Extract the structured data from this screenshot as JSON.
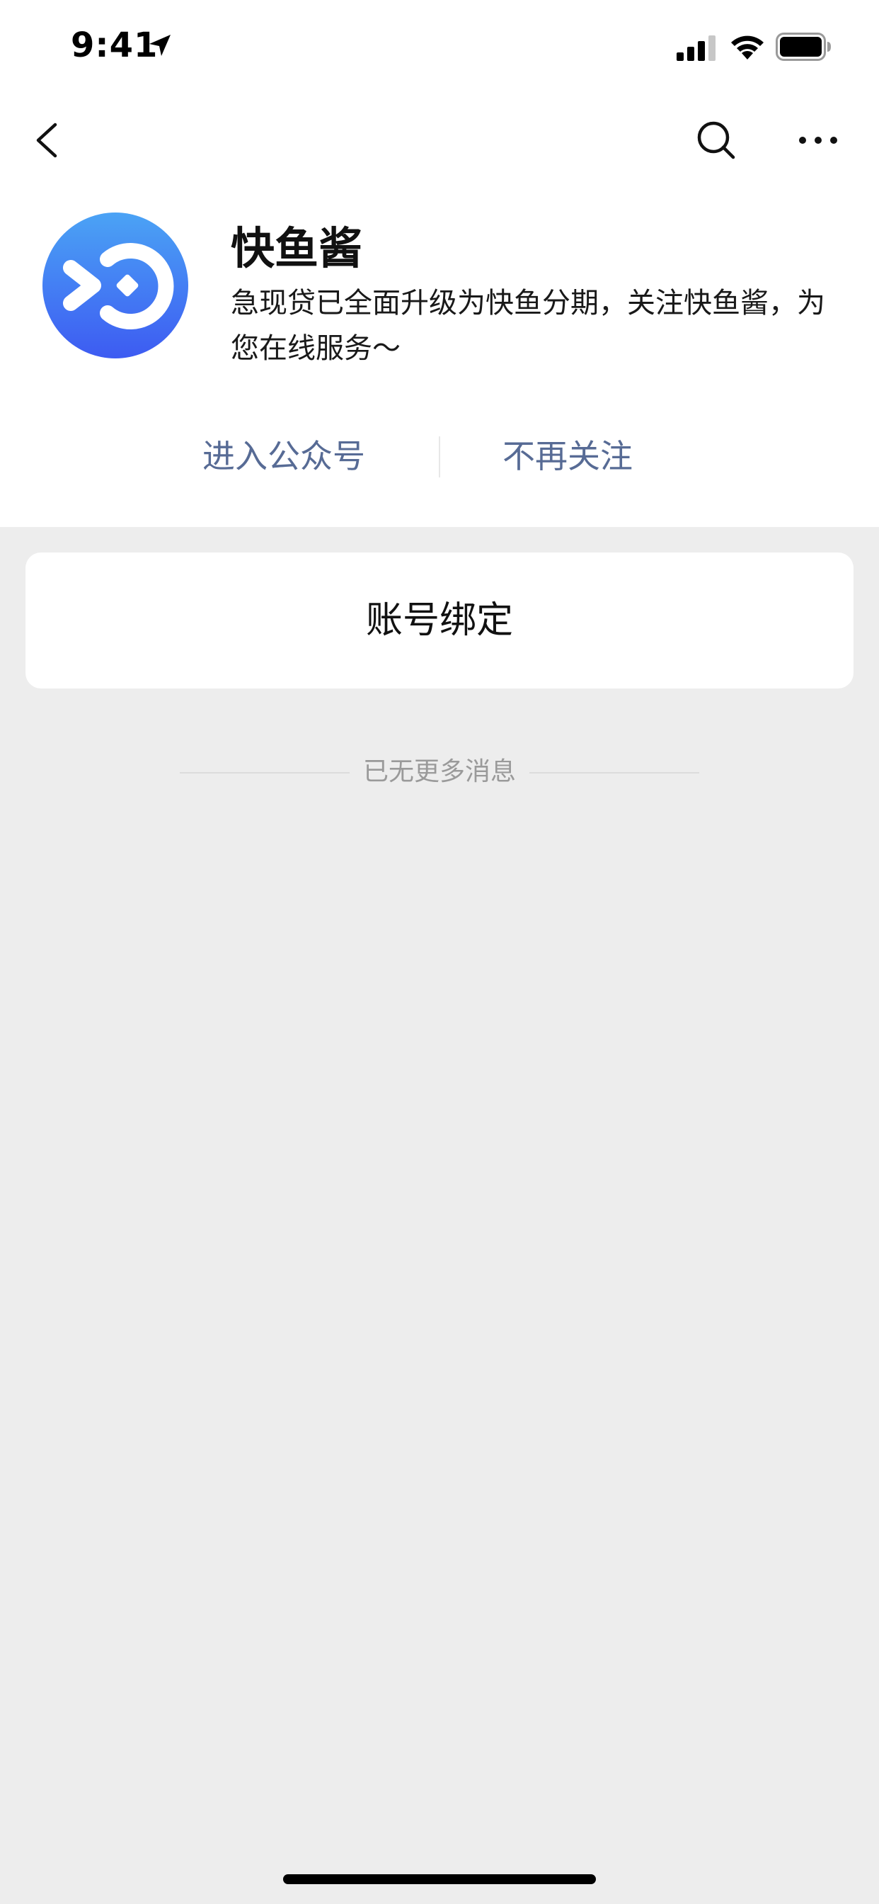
{
  "status_bar": {
    "time": "9:41",
    "location_icon": "location-arrow-icon",
    "signal_icon": "cellular-signal-icon",
    "wifi_icon": "wifi-icon",
    "battery_icon": "battery-icon"
  },
  "nav": {
    "back_icon": "chevron-left-icon",
    "search_icon": "search-icon",
    "more_icon": "more-horizontal-icon"
  },
  "profile": {
    "avatar_icon": "kuaiyu-logo-icon",
    "name": "快鱼酱",
    "description": "急现贷已全面升级为快鱼分期，关注快鱼酱，为您在线服务～",
    "enter_label": "进入公众号",
    "unfollow_label": "不再关注"
  },
  "menu": {
    "label": "账号绑定"
  },
  "messages": {
    "no_more_label": "已无更多消息"
  },
  "colors": {
    "link": "#576B95",
    "background": "#EDEDED",
    "card": "#FFFFFF",
    "avatar_top": "#4BA3F5",
    "avatar_bottom": "#3D5BF2"
  }
}
